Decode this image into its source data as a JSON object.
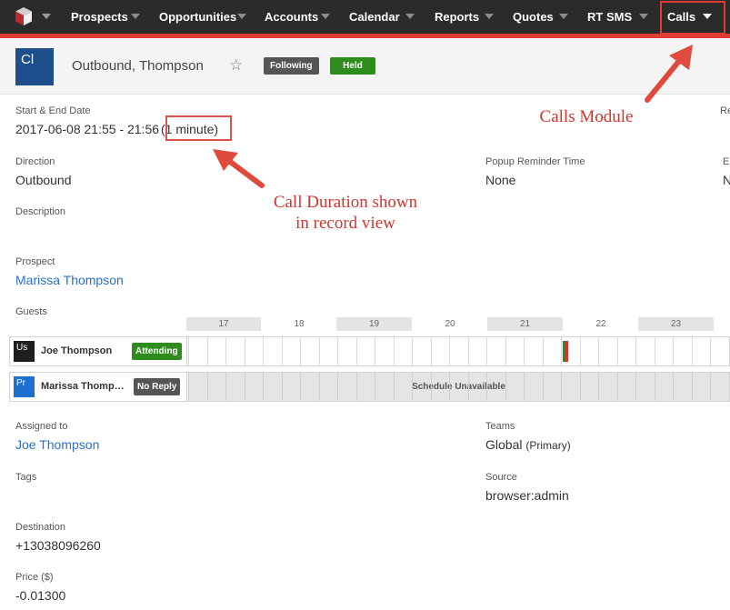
{
  "nav": {
    "items": [
      {
        "label": "Prospects"
      },
      {
        "label": "Opportunities"
      },
      {
        "label": "Accounts"
      },
      {
        "label": "Calendar"
      },
      {
        "label": "Reports"
      },
      {
        "label": "Quotes"
      },
      {
        "label": "RT SMS"
      },
      {
        "label": "Calls"
      }
    ],
    "accent_color": "#e23a34"
  },
  "record": {
    "avatar_text": "Cl",
    "title": "Outbound, Thompson",
    "following_label": "Following",
    "status_label": "Held",
    "status_color": "#2e8b1e"
  },
  "fields": {
    "start_end_label": "Start & End Date",
    "start_end_value": "2017-06-08 21:55 - 21:56",
    "duration": "(1 minute)",
    "re_label": "Re",
    "direction_label": "Direction",
    "direction_value": "Outbound",
    "popup_label": "Popup Reminder Time",
    "popup_value": "None",
    "e_label": "E",
    "n_value": "N",
    "description_label": "Description",
    "prospect_label": "Prospect",
    "prospect_value": "Marissa Thompson",
    "guests_label": "Guests",
    "assigned_label": "Assigned to",
    "assigned_value": "Joe Thompson",
    "teams_label": "Teams",
    "teams_value": "Global",
    "teams_primary": "(Primary)",
    "tags_label": "Tags",
    "source_label": "Source",
    "source_value": "browser:admin",
    "destination_label": "Destination",
    "destination_value": "+13038096260",
    "price_label": "Price ($)",
    "price_value": "-0.01300"
  },
  "guests": {
    "hours": [
      "17",
      "18",
      "19",
      "20",
      "21",
      "22",
      "23"
    ],
    "rows": [
      {
        "avatar": "Us",
        "name": "Joe Thompson",
        "status": "Attending",
        "status_color": "#2e8b1e",
        "avatar_color": "#222222"
      },
      {
        "avatar": "Pr",
        "name": "Marissa Thomp…",
        "status": "No Reply",
        "status_color": "#555555",
        "avatar_color": "#1f6fd1",
        "schedule": "Schedule Unavailable"
      }
    ]
  },
  "annotations": {
    "calls_module": "Calls Module",
    "duration_line1": "Call Duration shown",
    "duration_line2": "in record view"
  }
}
